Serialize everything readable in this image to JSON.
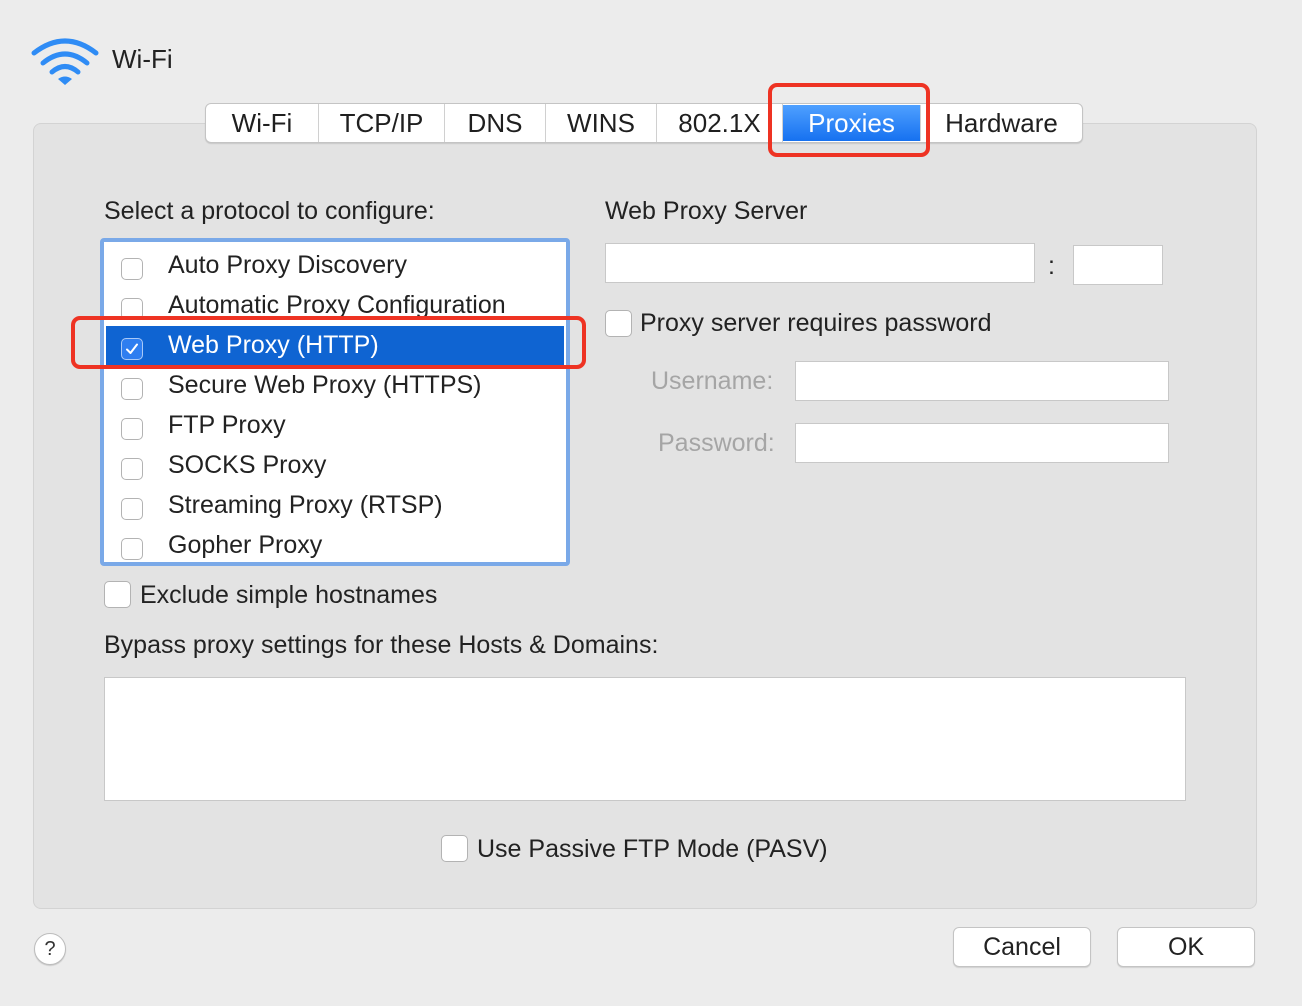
{
  "window": {
    "title": "Wi-Fi",
    "icon": "wifi-icon"
  },
  "tabs": [
    {
      "label": "Wi-Fi",
      "active": false
    },
    {
      "label": "TCP/IP",
      "active": false
    },
    {
      "label": "DNS",
      "active": false
    },
    {
      "label": "WINS",
      "active": false
    },
    {
      "label": "802.1X",
      "active": false
    },
    {
      "label": "Proxies",
      "active": true
    },
    {
      "label": "Hardware",
      "active": false
    }
  ],
  "protocols": {
    "heading": "Select a protocol to configure:",
    "items": [
      {
        "label": "Auto Proxy Discovery",
        "checked": false,
        "selected": false
      },
      {
        "label": "Automatic Proxy Configuration",
        "checked": false,
        "selected": false
      },
      {
        "label": "Web Proxy (HTTP)",
        "checked": true,
        "selected": true
      },
      {
        "label": "Secure Web Proxy (HTTPS)",
        "checked": false,
        "selected": false
      },
      {
        "label": "FTP Proxy",
        "checked": false,
        "selected": false
      },
      {
        "label": "SOCKS Proxy",
        "checked": false,
        "selected": false
      },
      {
        "label": "Streaming Proxy (RTSP)",
        "checked": false,
        "selected": false
      },
      {
        "label": "Gopher Proxy",
        "checked": false,
        "selected": false
      }
    ]
  },
  "server": {
    "heading": "Web Proxy Server",
    "host_value": "",
    "separator": ":",
    "port_value": "",
    "requires_password_label": "Proxy server requires password",
    "requires_password_checked": false,
    "username_label": "Username:",
    "username_value": "",
    "password_label": "Password:",
    "password_value": ""
  },
  "exclude_simple_hostnames": {
    "label": "Exclude simple hostnames",
    "checked": false
  },
  "bypass": {
    "label": "Bypass proxy settings for these Hosts & Domains:",
    "value": ""
  },
  "passive_ftp": {
    "label": "Use Passive FTP Mode (PASV)",
    "checked": false
  },
  "buttons": {
    "help": "?",
    "cancel": "Cancel",
    "ok": "OK"
  },
  "colors": {
    "accent": "#1671f0",
    "highlight_annotation": "#ee3323",
    "selection": "#0f64d2"
  }
}
